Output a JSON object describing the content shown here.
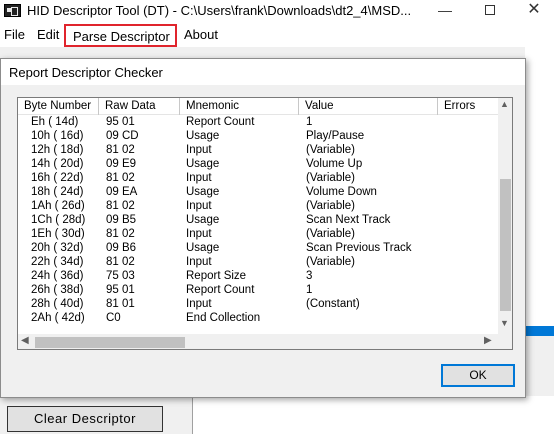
{
  "window": {
    "title": "HID Descriptor Tool (DT) - C:\\Users\\frank\\Downloads\\dt2_4\\MSD...",
    "minimize_glyph": "—",
    "close_glyph": "✕"
  },
  "menu": {
    "file": "File",
    "edit": "Edit",
    "parse": "Parse Descriptor",
    "about": "About"
  },
  "highlight_color": "#e0242c",
  "accent_color": "#0078d7",
  "dialog": {
    "title": "Report Descriptor Checker",
    "ok_label": "OK",
    "columns": [
      "Byte Number",
      "Raw Data",
      "Mnemonic",
      "Value",
      "Errors"
    ],
    "rows": [
      [
        "Eh ( 14d)",
        "95 01",
        "Report Count",
        "1"
      ],
      [
        "10h ( 16d)",
        "09 CD",
        "Usage",
        "Play/Pause"
      ],
      [
        "12h ( 18d)",
        "81 02",
        "Input",
        "(Variable)"
      ],
      [
        "14h ( 20d)",
        "09 E9",
        "Usage",
        "Volume Up"
      ],
      [
        "16h ( 22d)",
        "81 02",
        "Input",
        "(Variable)"
      ],
      [
        "18h ( 24d)",
        "09 EA",
        "Usage",
        "Volume Down"
      ],
      [
        "1Ah ( 26d)",
        "81 02",
        "Input",
        "(Variable)"
      ],
      [
        "1Ch ( 28d)",
        "09 B5",
        "Usage",
        "Scan Next Track"
      ],
      [
        "1Eh ( 30d)",
        "81 02",
        "Input",
        "(Variable)"
      ],
      [
        "20h ( 32d)",
        "09 B6",
        "Usage",
        "Scan Previous Track"
      ],
      [
        "22h ( 34d)",
        "81 02",
        "Input",
        "(Variable)"
      ],
      [
        "24h ( 36d)",
        "75 03",
        "Report Size",
        "3"
      ],
      [
        "26h ( 38d)",
        "95 01",
        "Report Count",
        "1"
      ],
      [
        "28h ( 40d)",
        "81 01",
        "Input",
        "(Constant)"
      ],
      [
        "2Ah ( 42d)",
        "C0",
        "End Collection",
        ""
      ]
    ]
  },
  "background": {
    "clear_button": "Clear Descriptor"
  }
}
